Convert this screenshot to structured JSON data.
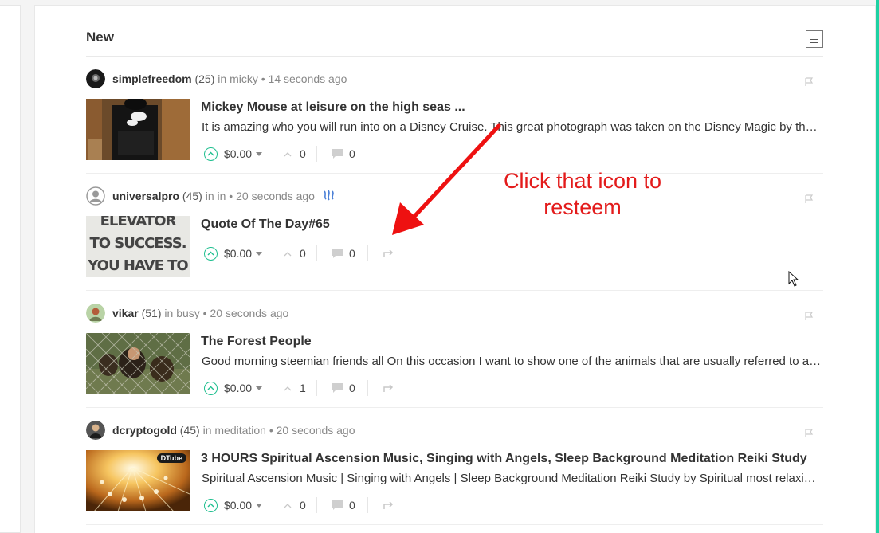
{
  "feed": {
    "title": "New"
  },
  "posts": [
    {
      "author": "simplefreedom",
      "reputation": "(25)",
      "community_prefix": " in ",
      "community": "micky",
      "time": " • 14 seconds ago",
      "title": "Mickey Mouse at leisure on the high seas ...",
      "excerpt": "It is amazing who you will run into on a Disney Cruise. This great photograph was taken on the Disney Magic by the ship's photographer.",
      "payout": "$0.00",
      "votes": "0",
      "comments": "0",
      "has_resteem": false,
      "steem_badge": false
    },
    {
      "author": "universalpro",
      "reputation": "(45)",
      "community_prefix": " in ",
      "community": "in",
      "time": " • 20 seconds ago",
      "title": "Quote Of The Day#65",
      "excerpt": "",
      "payout": "$0.00",
      "votes": "0",
      "comments": "0",
      "has_resteem": true,
      "steem_badge": true,
      "thumb_text": [
        "ELEVATOR",
        "TO SUCCESS.",
        "YOU HAVE TO"
      ]
    },
    {
      "author": "vikar",
      "reputation": "(51)",
      "community_prefix": " in ",
      "community": "busy",
      "time": " • 20 seconds ago",
      "title": "The Forest People",
      "excerpt": "Good morning steemian friends all On this occasion I want to show one of the animals that are usually referred to as the forest people.",
      "payout": "$0.00",
      "votes": "1",
      "comments": "0",
      "has_resteem": true,
      "steem_badge": false
    },
    {
      "author": "dcryptogold",
      "reputation": "(45)",
      "community_prefix": " in ",
      "community": "meditation",
      "time": " • 20 seconds ago",
      "title": "3 HOURS Spiritual Ascension Music, Singing with Angels, Sleep Background Meditation Reiki Study",
      "excerpt": "Spiritual Ascension Music | Singing with Angels | Sleep Background Meditation Reiki Study by Spiritual most relaxing music",
      "payout": "$0.00",
      "votes": "0",
      "comments": "0",
      "has_resteem": true,
      "steem_badge": false,
      "thumb_badge": "DTube"
    }
  ],
  "annotation": {
    "line1": "Click that icon to",
    "line2": "resteem"
  },
  "colors": {
    "accent": "#1fd1a3",
    "upvote": "#1fbf8f",
    "annotation": "#e31b1b"
  }
}
